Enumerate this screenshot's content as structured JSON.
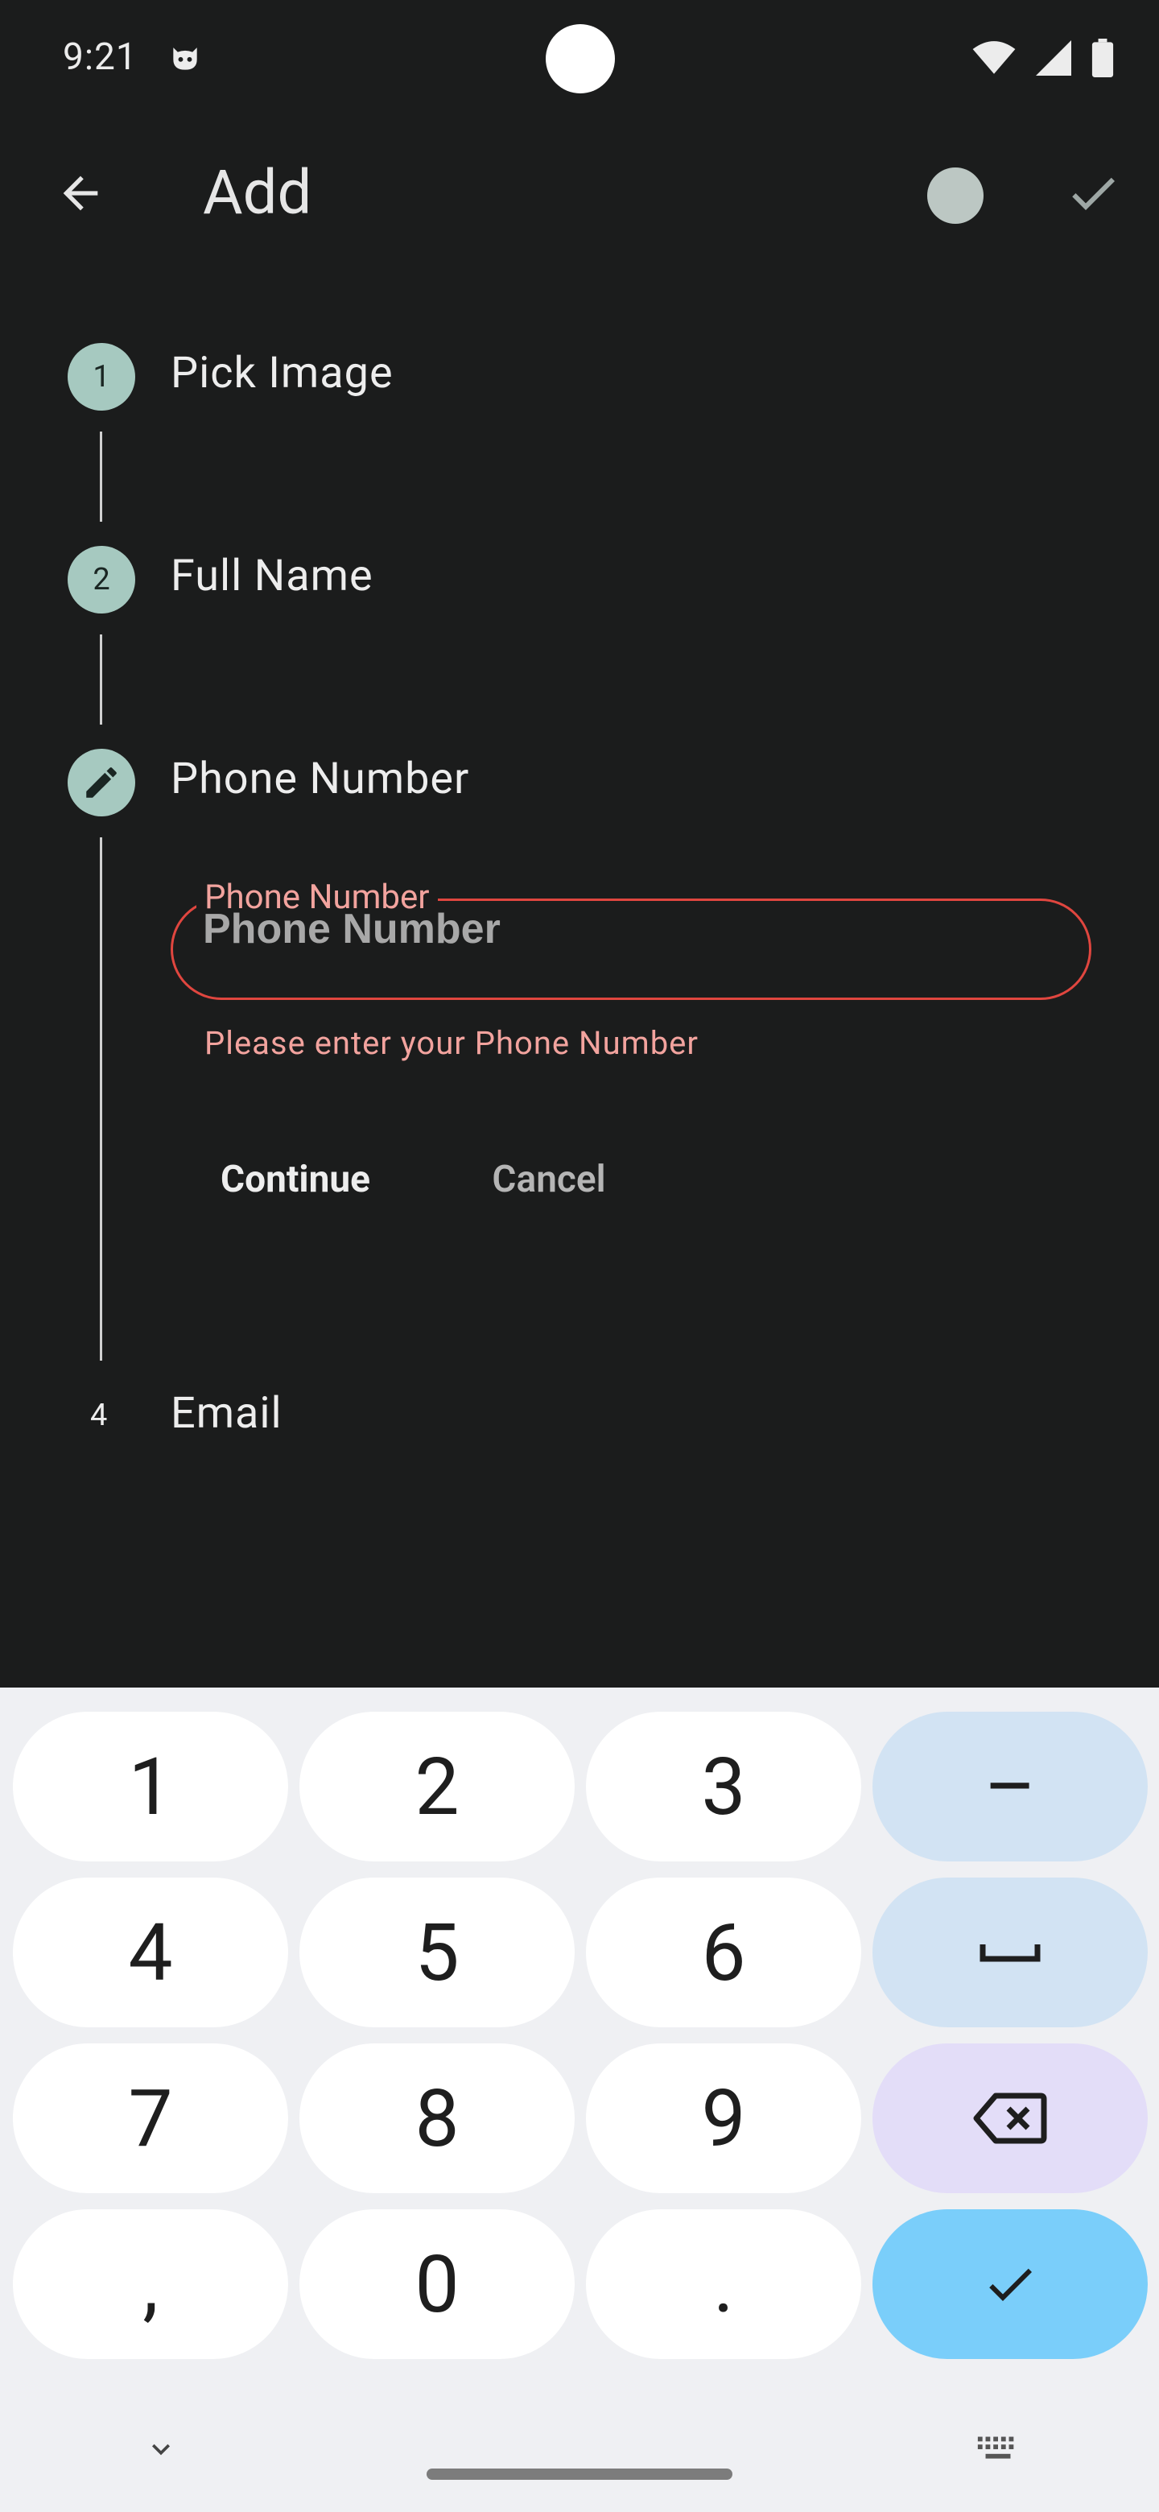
{
  "status_bar": {
    "time": "9:21"
  },
  "app_bar": {
    "title": "Add"
  },
  "steps": [
    {
      "number": "1",
      "title": "Pick Image"
    },
    {
      "number": "2",
      "title": "Full Name"
    },
    {
      "number": "",
      "title": "Phone Number"
    },
    {
      "number": "4",
      "title": "Email"
    }
  ],
  "phone_field": {
    "label": "Phone Number",
    "placeholder": "Phone Number",
    "value": "",
    "error": "Please enter your Phone Number"
  },
  "actions": {
    "continue_label": "Continue",
    "cancel_label": "Cancel"
  },
  "keyboard": {
    "keys": [
      "1",
      "2",
      "3",
      "–",
      "4",
      "5",
      "6",
      "7",
      "8",
      "9",
      ",",
      "0",
      "."
    ],
    "icons": [
      "space-icon",
      "backspace-icon",
      "done-check-icon",
      "chevron-down-icon",
      "keyboard-icon"
    ]
  },
  "colors": {
    "background": "#1b1c1c",
    "step_circle": "#a6c9c0",
    "error": "#e0463f",
    "error_text": "#f2a39e",
    "keyboard_bg": "#eff0f3",
    "key_blue": "#d2e3f3",
    "key_purple": "#e3ddf8",
    "key_action": "#7acefa"
  }
}
